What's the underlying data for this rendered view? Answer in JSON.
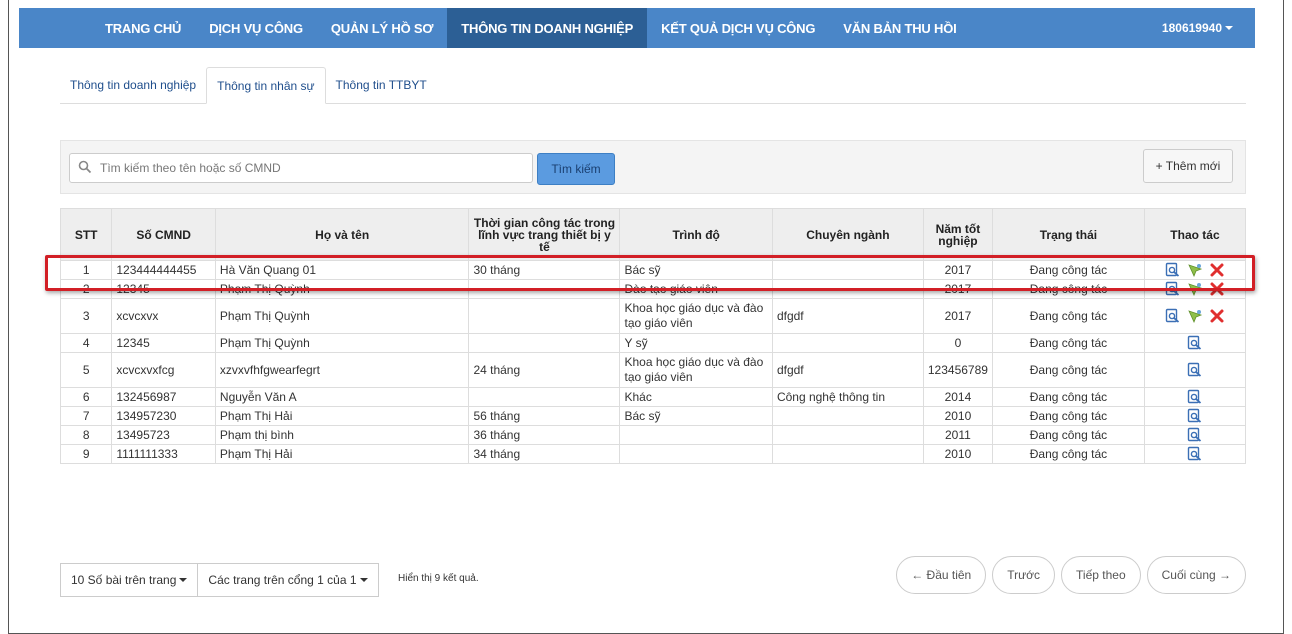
{
  "nav": {
    "items": [
      {
        "label": "TRANG CHỦ"
      },
      {
        "label": "DỊCH VỤ CÔNG"
      },
      {
        "label": "QUẢN LÝ HỒ SƠ"
      },
      {
        "label": "THÔNG TIN DOANH NGHIỆP"
      },
      {
        "label": "KẾT QUẢ DỊCH VỤ CÔNG"
      },
      {
        "label": "VĂN BẢN THU HỒI"
      }
    ],
    "active_index": 3,
    "user": "180619940"
  },
  "tabs": [
    {
      "label": "Thông tin doanh nghiệp"
    },
    {
      "label": "Thông tin nhân sự"
    },
    {
      "label": "Thông tin TTBYT"
    }
  ],
  "active_tab": 1,
  "search": {
    "placeholder": "Tìm kiếm theo tên hoặc số CMND",
    "button": "Tìm kiếm",
    "add_button": "+ Thêm mới"
  },
  "table": {
    "headers": [
      "STT",
      "Số CMND",
      "Họ và tên",
      "Thời gian công tác trong lĩnh vực trang thiết bị y tế",
      "Trình độ",
      "Chuyên ngành",
      "Năm tốt nghiệp",
      "Trạng thái",
      "Thao tác"
    ],
    "rows": [
      {
        "stt": "1",
        "cmnd": "123444444455",
        "name": "Hà Văn Quang 01",
        "time": "30 tháng",
        "level": "Bác sỹ",
        "major": "",
        "year": "2017",
        "status": "Đang công tác",
        "actions": "view-edit-delete"
      },
      {
        "stt": "2",
        "cmnd": "12345",
        "name": "Phạm Thị Quỳnh",
        "time": "",
        "level": "Đào tạo giáo viên",
        "major": "",
        "year": "2017",
        "status": "Đang công tác",
        "actions": "view-edit-delete"
      },
      {
        "stt": "3",
        "cmnd": "xcvcxvx",
        "name": "Phạm Thị Quỳnh",
        "time": "",
        "level": "Khoa học giáo dục và đào tạo giáo viên",
        "major": "dfgdf",
        "year": "2017",
        "status": "Đang công tác",
        "actions": "view-edit-delete"
      },
      {
        "stt": "4",
        "cmnd": "12345",
        "name": "Phạm Thị Quỳnh",
        "time": "",
        "level": "Y sỹ",
        "major": "",
        "year": "0",
        "status": "Đang công tác",
        "actions": "view"
      },
      {
        "stt": "5",
        "cmnd": "xcvcxvxfcg",
        "name": "xzvxvfhfgwearfegrt",
        "time": "24 tháng",
        "level": "Khoa học giáo dục và đào tạo giáo viên",
        "major": "dfgdf",
        "year": "123456789",
        "status": "Đang công tác",
        "actions": "view"
      },
      {
        "stt": "6",
        "cmnd": "132456987",
        "name": "Nguyễn Văn A",
        "time": "",
        "level": "Khác",
        "major": "Công nghệ thông tin",
        "year": "2014",
        "status": "Đang công tác",
        "actions": "view"
      },
      {
        "stt": "7",
        "cmnd": "134957230",
        "name": "Phạm Thị Hải",
        "time": "56 tháng",
        "level": "Bác sỹ",
        "major": "",
        "year": "2010",
        "status": "Đang công tác",
        "actions": "view"
      },
      {
        "stt": "8",
        "cmnd": "13495723",
        "name": "Phạm thị bình",
        "time": "36 tháng",
        "level": "",
        "major": "",
        "year": "2011",
        "status": "Đang công tác",
        "actions": "view"
      },
      {
        "stt": "9",
        "cmnd": "1111111333",
        "name": "Phạm Thị Hải",
        "time": "34 tháng",
        "level": "",
        "major": "",
        "year": "2010",
        "status": "Đang công tác",
        "actions": "view"
      }
    ]
  },
  "footer": {
    "page_size": "10 Số bài trên trang",
    "page_select": "Các trang trên cổng 1 của 1",
    "info": "Hiển thị 9 kết quả.",
    "first": "← Đầu tiên",
    "prev": "Trước",
    "next": "Tiếp theo",
    "last": "Cuối cùng →"
  },
  "colors": {
    "nav_bg": "#4a86c8",
    "nav_active": "#2c5f95",
    "highlight": "#d21f26",
    "delete": "#e02f2f"
  }
}
